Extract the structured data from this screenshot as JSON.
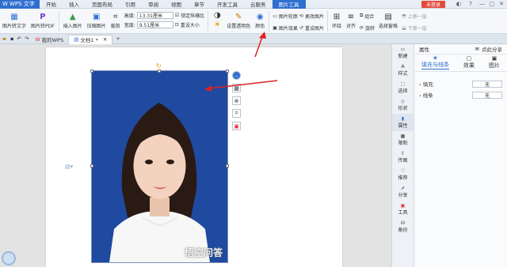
{
  "titlebar": {
    "app": "WPS 文字",
    "tabs": [
      "开始",
      "插入",
      "页面布局",
      "引用",
      "审阅",
      "视图",
      "章节",
      "开发工具",
      "云服务",
      "图片工具"
    ],
    "active_tab": "图片工具",
    "login": "未登录"
  },
  "ribbon": {
    "img_to_text": "图片转文字",
    "img_to_pdf": "图片转PDF",
    "insert_img": "插入图片",
    "compress": "压缩图片",
    "crop": "裁剪",
    "height_label": "高度:",
    "height_value": "13.31厘米",
    "width_label": "宽度:",
    "width_value": "9.51厘米",
    "lock_ratio": "锁定纵横比",
    "reset_size": "重设大小",
    "set_transparent": "设置透明色",
    "color": "颜色",
    "outline": "图片轮廓",
    "effect": "图片效果",
    "change": "更改图片",
    "reset": "重设图片",
    "wrap": "环绕",
    "align": "对齐",
    "group": "组合",
    "rotate": "旋转",
    "selection": "选择窗格",
    "up": "上移一层",
    "down": "下移一层"
  },
  "tabs": {
    "my_wps": "我的WPS",
    "doc": "文档1 *"
  },
  "rightbar": [
    "新建",
    "样式",
    "选择",
    "形状",
    "属性",
    "限制",
    "传图",
    "推荐",
    "分享",
    "工具",
    "备份"
  ],
  "panel": {
    "title": "属性",
    "share": "点此分享",
    "tabs": [
      "填充与线条",
      "效果",
      "图片"
    ],
    "fill": "填充",
    "line": "线条",
    "none": "无"
  },
  "watermark": "悟空问答"
}
